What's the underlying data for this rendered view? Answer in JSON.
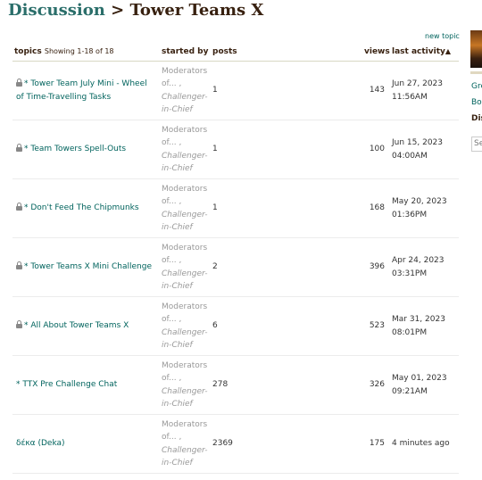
{
  "breadcrumb": {
    "discussion": "Discussion",
    "separator": ">",
    "group": "Tower Teams X"
  },
  "new_topic": "new topic",
  "table": {
    "headers": {
      "topics": "topics",
      "showing": "Showing 1-18 of 18",
      "started_by": "started by",
      "posts": "posts",
      "views": "views",
      "last_activity": "last activity"
    },
    "rows": [
      {
        "locked": true,
        "title": "* Tower Team July Mini - Wheel of Time-Travelling Tasks",
        "starter_a": "Moderators of... ,",
        "starter_b": "Challenger-in-Chief",
        "posts": "1",
        "views": "143",
        "activity": "Jun 27, 2023 11:56AM"
      },
      {
        "locked": true,
        "title": "* Team Towers Spell-Outs",
        "starter_a": "Moderators of... ,",
        "starter_b": "Challenger-in-Chief",
        "posts": "1",
        "views": "100",
        "activity": "Jun 15, 2023 04:00AM"
      },
      {
        "locked": true,
        "title": "* Don't Feed The Chipmunks",
        "starter_a": "Moderators of... ,",
        "starter_b": "Challenger-in-Chief",
        "posts": "1",
        "views": "168",
        "activity": "May 20, 2023 01:36PM"
      },
      {
        "locked": true,
        "title": "* Tower Teams X Mini Challenge",
        "starter_a": "Moderators of... ,",
        "starter_b": "Challenger-in-Chief",
        "posts": "2",
        "views": "396",
        "activity": "Apr 24, 2023 03:31PM"
      },
      {
        "locked": true,
        "title": "* All About Tower Teams X",
        "starter_a": "Moderators of... ,",
        "starter_b": "Challenger-in-Chief",
        "posts": "6",
        "views": "523",
        "activity": "Mar 31, 2023 08:01PM"
      },
      {
        "locked": false,
        "title": "* TTX Pre Challenge Chat",
        "starter_a": "Moderators of... ,",
        "starter_b": "Challenger-in-Chief",
        "posts": "278",
        "views": "326",
        "activity": "May 01, 2023 09:21AM"
      },
      {
        "locked": false,
        "title": "δέκα (Deka)",
        "starter_a": "Moderators of... ,",
        "starter_b": "Challenger-in-Chief",
        "posts": "2369",
        "views": "175",
        "activity": "4 minutes ago"
      }
    ]
  },
  "sidebar": {
    "link1": "Gre",
    "link2": "Bo",
    "current": "Dis",
    "search_placeholder": "Se"
  },
  "icons": {
    "lock": "lock-icon",
    "sort": "sort-ascending-icon"
  },
  "colors": {
    "link": "#00635d",
    "heading": "#2a6e6a",
    "text_dark": "#382110",
    "muted": "#999999"
  }
}
